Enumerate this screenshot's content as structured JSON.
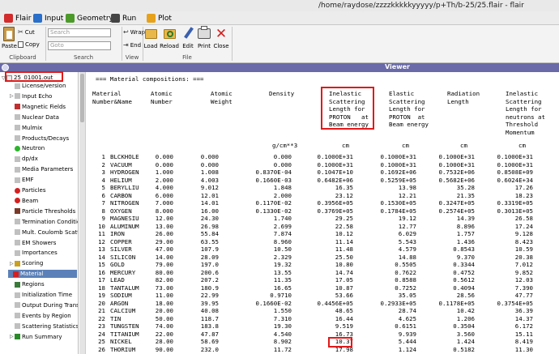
{
  "window_title": "/home/raydose/zzzzkkkkkyyyyy/p+Th/b-25/25.flair - flair",
  "tabs": [
    {
      "label": "Flair",
      "icon": "flair-icon",
      "color": "#d22c2c"
    },
    {
      "label": "Input",
      "icon": "input-icon",
      "color": "#2a6fc9"
    },
    {
      "label": "Geometry",
      "icon": "geometry-icon",
      "color": "#4c9a2a"
    },
    {
      "label": "Run",
      "icon": "run-icon",
      "color": "#444444"
    },
    {
      "label": "Plot",
      "icon": "plot-icon",
      "color": "#e6a21c"
    }
  ],
  "ribbon": {
    "paste": "Paste",
    "cut": "Cut",
    "copy": "Copy",
    "clipboard": "Clipboard",
    "search_placeholder": "Search",
    "goto_placeholder": "Goto",
    "search_group": "Search",
    "wrap": "Wrap",
    "end": "End",
    "view_group": "View",
    "load": "Load",
    "reload": "Reload",
    "edit": "Edit",
    "print": "Print",
    "close": "Close",
    "file_group": "File"
  },
  "viewer_title": "Viewer",
  "tree": {
    "root": "25_01001.out",
    "items": [
      {
        "label": "License/version",
        "icon": "doc-icon",
        "color": "#c0c0c0",
        "exp": ""
      },
      {
        "label": "Input Echo",
        "icon": "doc-icon",
        "color": "#c0c0c0",
        "exp": "▷"
      },
      {
        "label": "Magnetic Fields",
        "icon": "magnet-icon",
        "color": "#c03030",
        "exp": ""
      },
      {
        "label": "Nuclear Data",
        "icon": "doc-icon",
        "color": "#c0c0c0",
        "exp": ""
      },
      {
        "label": "Mulmix",
        "icon": "doc-icon",
        "color": "#c0c0c0",
        "exp": ""
      },
      {
        "label": "Products/Decays",
        "icon": "doc-icon",
        "color": "#c0c0c0",
        "exp": ""
      },
      {
        "label": "Neutron",
        "icon": "neutron-icon",
        "color": "#2cb52c",
        "exp": ""
      },
      {
        "label": "dp/dx",
        "icon": "doc-icon",
        "color": "#c0c0c0",
        "exp": ""
      },
      {
        "label": "Media Parameters",
        "icon": "doc-icon",
        "color": "#c0c0c0",
        "exp": ""
      },
      {
        "label": "EMF",
        "icon": "doc-icon",
        "color": "#c0c0c0",
        "exp": ""
      },
      {
        "label": "Particles",
        "icon": "particles-icon",
        "color": "#d42020",
        "exp": ""
      },
      {
        "label": "Beam",
        "icon": "beam-icon",
        "color": "#d42020",
        "exp": ""
      },
      {
        "label": "Particle Thresholds",
        "icon": "thresholds-icon",
        "color": "#7a3a2a",
        "exp": ""
      },
      {
        "label": "Termination Conditio",
        "icon": "doc-icon",
        "color": "#c0c0c0",
        "exp": ""
      },
      {
        "label": "Mult. Coulomb Scatte",
        "icon": "doc-icon",
        "color": "#c0c0c0",
        "exp": ""
      },
      {
        "label": "EM Showers",
        "icon": "doc-icon",
        "color": "#c0c0c0",
        "exp": ""
      },
      {
        "label": "Importances",
        "icon": "doc-icon",
        "color": "#c0c0c0",
        "exp": ""
      },
      {
        "label": "Scoring",
        "icon": "scoring-icon",
        "color": "#c9a020",
        "exp": "▷"
      },
      {
        "label": "Material",
        "icon": "material-icon",
        "color": "#d42020",
        "exp": "",
        "selected": true
      },
      {
        "label": "Regions",
        "icon": "regions-icon",
        "color": "#3a7a3a",
        "exp": ""
      },
      {
        "label": "Initialization Time",
        "icon": "doc-icon",
        "color": "#c0c0c0",
        "exp": ""
      },
      {
        "label": "Output During Trans",
        "icon": "doc-icon",
        "color": "#c0c0c0",
        "exp": ""
      },
      {
        "label": "Events by Region",
        "icon": "doc-icon",
        "color": "#c0c0c0",
        "exp": ""
      },
      {
        "label": "Scattering Statistics",
        "icon": "doc-icon",
        "color": "#c0c0c0",
        "exp": ""
      },
      {
        "label": "Run Summary",
        "icon": "summary-icon",
        "color": "#2a8a2a",
        "exp": "▷"
      }
    ]
  },
  "viewer": {
    "title_line": "=== Material compositions: ===",
    "headers": [
      "Material\nNumber&Name",
      "Atomic\nNumber",
      "Atomic\nWeight",
      "Density",
      "Inelastic\nScattering\nLength for\nPROTON   at\nBeam energy",
      "Elastic\nScattering\nLength for\nPROTON  at\nBeam energy",
      "Radiation\nLength",
      "Inelastic\nScattering\nLength for\nneutrons at\nThreshold\nMomentum"
    ],
    "units": [
      "g/cm**3",
      "cm",
      "cm",
      "cm",
      "cm"
    ],
    "rows": [
      [
        "1",
        "BLCKHOLE",
        "0.000",
        "0.000",
        "0.000",
        "0.1000E+31",
        "0.1000E+31",
        "0.1000E+31",
        "0.1000E+31"
      ],
      [
        "2",
        "VACUUM",
        "0.000",
        "0.000",
        "0.000",
        "0.1000E+31",
        "0.1000E+31",
        "0.1000E+31",
        "0.1000E+31"
      ],
      [
        "3",
        "HYDROGEN",
        "1.000",
        "1.008",
        "0.8370E-04",
        "0.1047E+10",
        "0.1692E+06",
        "0.7532E+06",
        "0.8508E+09"
      ],
      [
        "4",
        "HELIUM",
        "2.000",
        "4.003",
        "0.1660E-03",
        "0.6482E+06",
        "0.5259E+05",
        "0.5682E+06",
        "0.6024E+34"
      ],
      [
        "5",
        "BERYLLIU",
        "4.000",
        "9.012",
        "1.848",
        "16.35",
        "13.98",
        "35.28",
        "17.26"
      ],
      [
        "6",
        "CARBON",
        "6.000",
        "12.01",
        "2.000",
        "23.12",
        "12.21",
        "21.35",
        "18.23"
      ],
      [
        "7",
        "NITROGEN",
        "7.000",
        "14.01",
        "0.1170E-02",
        "0.3956E+05",
        "0.1530E+05",
        "0.3247E+05",
        "0.3319E+05"
      ],
      [
        "8",
        "OXYGEN",
        "8.000",
        "16.00",
        "0.1330E-02",
        "0.3769E+05",
        "0.1784E+05",
        "0.2574E+05",
        "0.3013E+05"
      ],
      [
        "9",
        "MAGNESIU",
        "12.00",
        "24.30",
        "1.740",
        "29.25",
        "19.12",
        "14.39",
        "26.58"
      ],
      [
        "10",
        "ALUMINUM",
        "13.00",
        "26.98",
        "2.699",
        "22.58",
        "12.77",
        "8.896",
        "17.24"
      ],
      [
        "11",
        "IRON",
        "26.00",
        "55.84",
        "7.874",
        "10.12",
        "6.029",
        "1.757",
        "9.128"
      ],
      [
        "12",
        "COPPER",
        "29.00",
        "63.55",
        "8.960",
        "11.14",
        "5.543",
        "1.436",
        "8.423"
      ],
      [
        "13",
        "SILVER",
        "47.00",
        "107.9",
        "10.50",
        "11.48",
        "4.579",
        "0.8543",
        "10.59"
      ],
      [
        "14",
        "SILICON",
        "14.00",
        "28.09",
        "2.329",
        "25.50",
        "14.88",
        "9.370",
        "20.38"
      ],
      [
        "15",
        "GOLD",
        "79.00",
        "197.0",
        "19.32",
        "10.80",
        "0.5505",
        "0.3344",
        "7.012"
      ],
      [
        "16",
        "MERCURY",
        "80.00",
        "200.6",
        "13.55",
        "14.74",
        "0.7622",
        "0.4752",
        "9.852"
      ],
      [
        "17",
        "LEAD",
        "82.00",
        "207.2",
        "11.35",
        "17.05",
        "0.8588",
        "0.5612",
        "12.03"
      ],
      [
        "18",
        "TANTALUM",
        "73.00",
        "180.9",
        "16.65",
        "10.87",
        "0.7252",
        "0.4094",
        "7.390"
      ],
      [
        "19",
        "SODIUM",
        "11.00",
        "22.99",
        "0.9710",
        "53.66",
        "35.05",
        "28.56",
        "47.77"
      ],
      [
        "20",
        "ARGON",
        "18.00",
        "39.95",
        "0.1660E-02",
        "0.4456E+05",
        "0.2933E+05",
        "0.1178E+05",
        "0.3754E+05"
      ],
      [
        "21",
        "CALCIUM",
        "20.00",
        "40.08",
        "1.550",
        "48.65",
        "28.74",
        "10.42",
        "36.39"
      ],
      [
        "22",
        "TIN",
        "50.00",
        "118.7",
        "7.310",
        "16.44",
        "4.625",
        "1.206",
        "14.37"
      ],
      [
        "23",
        "TUNGSTEN",
        "74.00",
        "183.8",
        "19.30",
        "9.519",
        "0.6151",
        "0.3504",
        "6.172"
      ],
      [
        "24",
        "TITANIUM",
        "22.00",
        "47.87",
        "4.540",
        "16.73",
        "9.939",
        "3.560",
        "15.11"
      ],
      [
        "25",
        "NICKEL",
        "28.00",
        "58.69",
        "8.902",
        "10.37",
        "5.444",
        "1.424",
        "8.419"
      ],
      [
        "26",
        "THORIUM",
        "90.00",
        "232.0",
        "11.72",
        "17.98",
        "1.124",
        "0.5182",
        "11.30"
      ]
    ]
  }
}
